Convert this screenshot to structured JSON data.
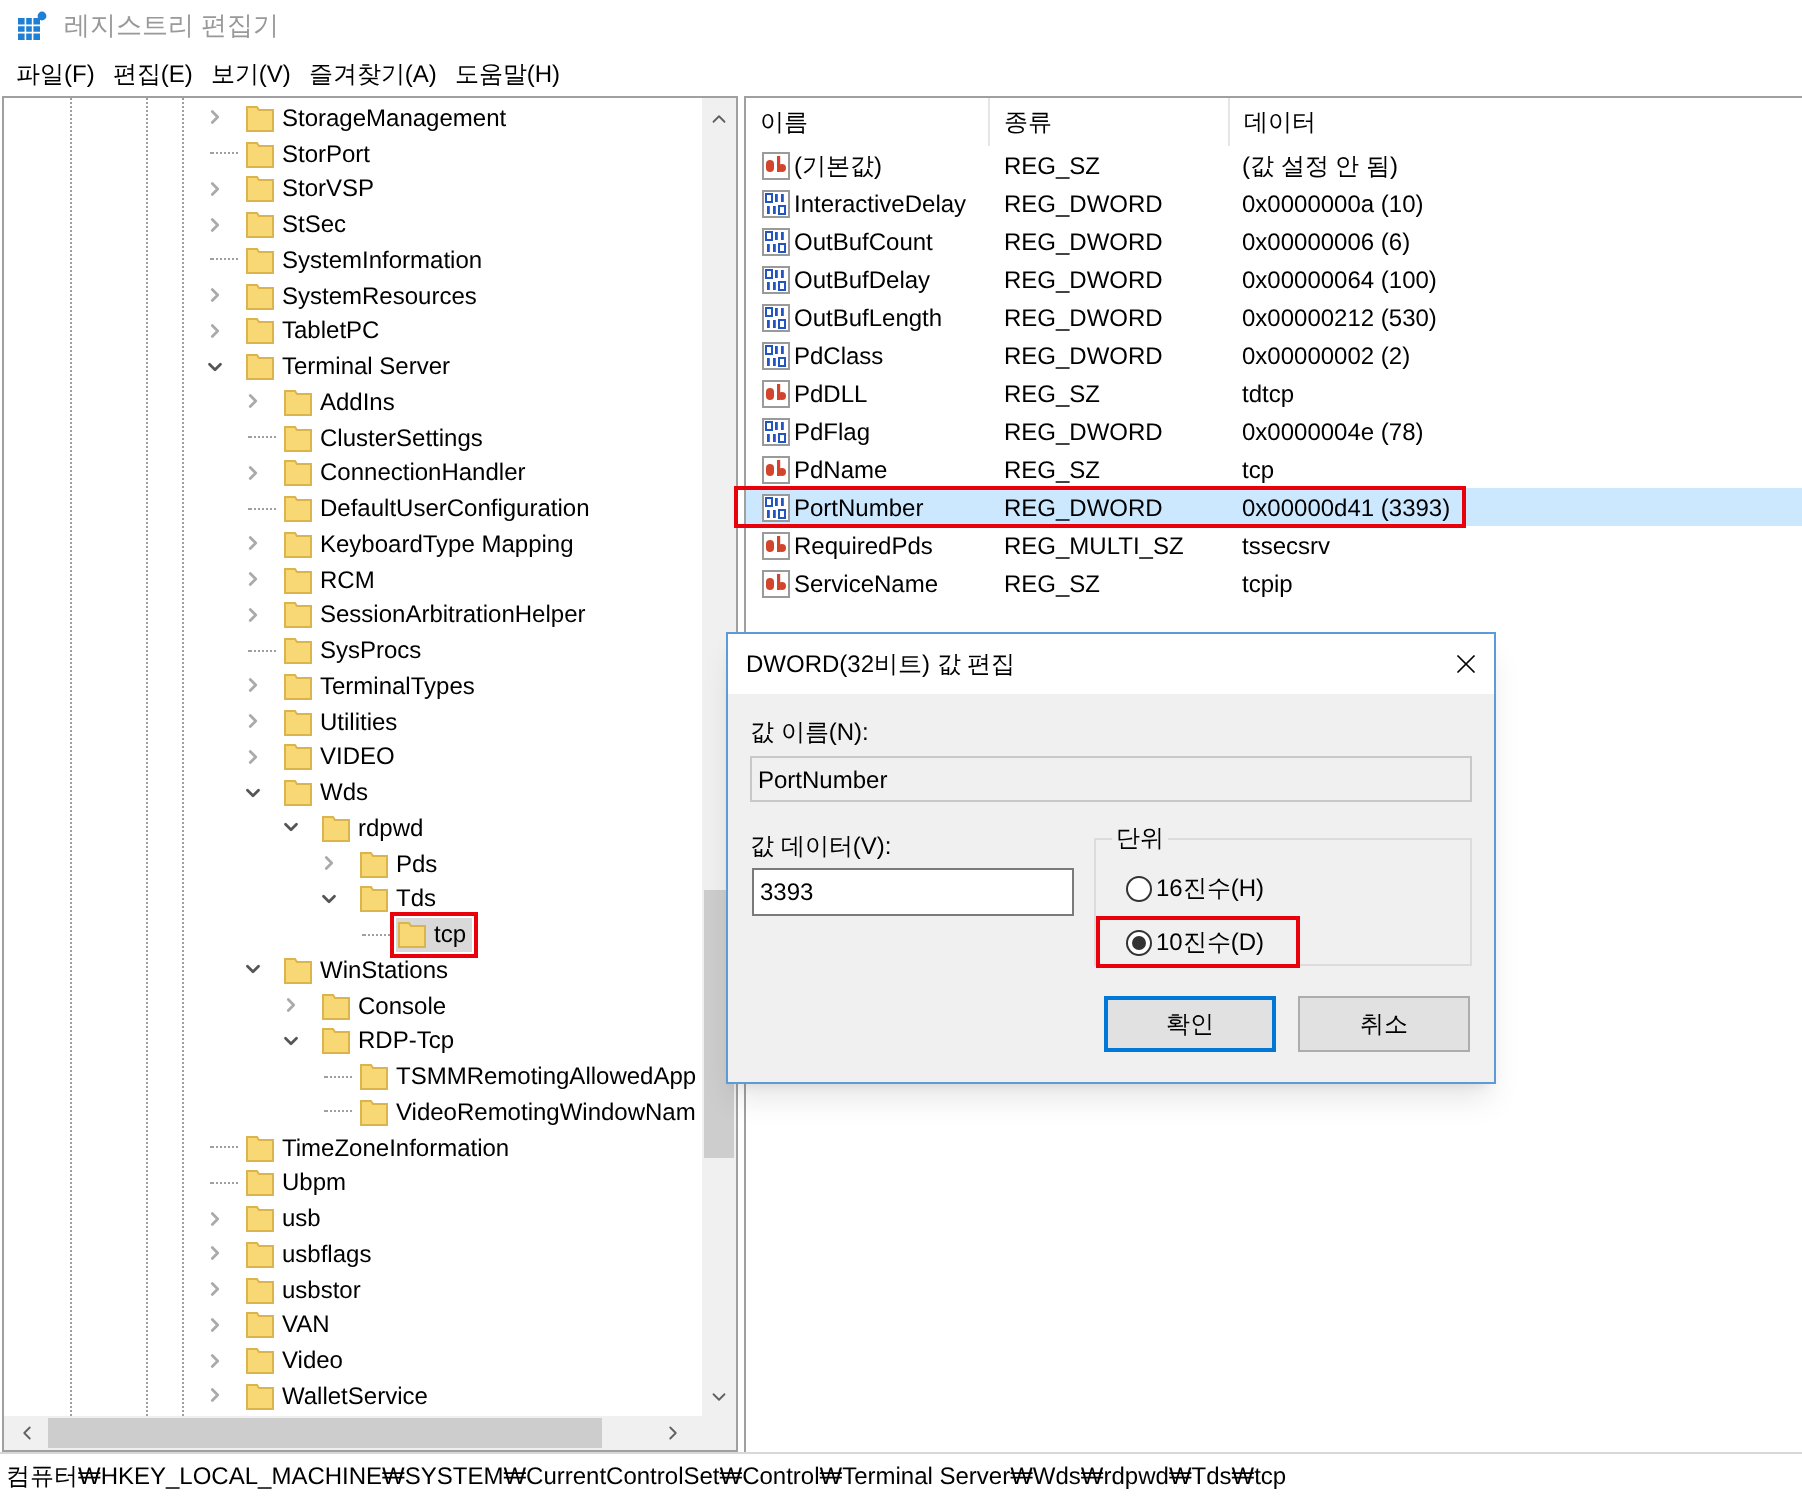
{
  "window": {
    "title": "레지스트리 편집기"
  },
  "menu": [
    "파일(F)",
    "편집(E)",
    "보기(V)",
    "즐겨찾기(A)",
    "도움말(H)"
  ],
  "tree": [
    {
      "label": "StorageManagement",
      "kind": "collapsed",
      "selected": false,
      "annotated": false
    },
    {
      "label": "StorPort",
      "kind": "leaf",
      "selected": false,
      "annotated": false
    },
    {
      "label": "StorVSP",
      "kind": "collapsed",
      "selected": false,
      "annotated": false
    },
    {
      "label": "StSec",
      "kind": "collapsed",
      "selected": false,
      "annotated": false
    },
    {
      "label": "SystemInformation",
      "kind": "leaf",
      "selected": false,
      "annotated": false
    },
    {
      "label": "SystemResources",
      "kind": "collapsed",
      "selected": false,
      "annotated": false
    },
    {
      "label": "TabletPC",
      "kind": "collapsed",
      "selected": false,
      "annotated": false
    },
    {
      "label": "Terminal Server",
      "kind": "expanded",
      "selected": false,
      "annotated": false,
      "children": [
        {
          "label": "AddIns",
          "kind": "collapsed",
          "selected": false,
          "annotated": false
        },
        {
          "label": "ClusterSettings",
          "kind": "leaf",
          "selected": false,
          "annotated": false
        },
        {
          "label": "ConnectionHandler",
          "kind": "collapsed",
          "selected": false,
          "annotated": false
        },
        {
          "label": "DefaultUserConfiguration",
          "kind": "leaf",
          "selected": false,
          "annotated": false
        },
        {
          "label": "KeyboardType Mapping",
          "kind": "collapsed",
          "selected": false,
          "annotated": false
        },
        {
          "label": "RCM",
          "kind": "collapsed",
          "selected": false,
          "annotated": false
        },
        {
          "label": "SessionArbitrationHelper",
          "kind": "collapsed",
          "selected": false,
          "annotated": false
        },
        {
          "label": "SysProcs",
          "kind": "leaf",
          "selected": false,
          "annotated": false
        },
        {
          "label": "TerminalTypes",
          "kind": "collapsed",
          "selected": false,
          "annotated": false
        },
        {
          "label": "Utilities",
          "kind": "collapsed",
          "selected": false,
          "annotated": false
        },
        {
          "label": "VIDEO",
          "kind": "collapsed",
          "selected": false,
          "annotated": false
        },
        {
          "label": "Wds",
          "kind": "expanded",
          "selected": false,
          "annotated": false,
          "children": [
            {
              "label": "rdpwd",
              "kind": "expanded",
              "selected": false,
              "annotated": false,
              "children": [
                {
                  "label": "Pds",
                  "kind": "collapsed",
                  "selected": false,
                  "annotated": false
                },
                {
                  "label": "Tds",
                  "kind": "expanded",
                  "selected": false,
                  "annotated": false,
                  "children": [
                    {
                      "label": "tcp",
                      "kind": "leaf",
                      "selected": true,
                      "annotated": true
                    }
                  ]
                }
              ]
            }
          ]
        },
        {
          "label": "WinStations",
          "kind": "expanded",
          "selected": false,
          "annotated": false,
          "children": [
            {
              "label": "Console",
              "kind": "collapsed",
              "selected": false,
              "annotated": false
            },
            {
              "label": "RDP-Tcp",
              "kind": "expanded",
              "selected": false,
              "annotated": false,
              "children": [
                {
                  "label": "TSMMRemotingAllowedApp",
                  "kind": "leaf",
                  "selected": false,
                  "annotated": false
                },
                {
                  "label": "VideoRemotingWindowNam",
                  "kind": "leaf",
                  "selected": false,
                  "annotated": false
                }
              ]
            }
          ]
        }
      ]
    },
    {
      "label": "TimeZoneInformation",
      "kind": "leaf",
      "selected": false,
      "annotated": false
    },
    {
      "label": "Ubpm",
      "kind": "leaf",
      "selected": false,
      "annotated": false
    },
    {
      "label": "usb",
      "kind": "collapsed",
      "selected": false,
      "annotated": false
    },
    {
      "label": "usbflags",
      "kind": "collapsed",
      "selected": false,
      "annotated": false
    },
    {
      "label": "usbstor",
      "kind": "collapsed",
      "selected": false,
      "annotated": false
    },
    {
      "label": "VAN",
      "kind": "collapsed",
      "selected": false,
      "annotated": false
    },
    {
      "label": "Video",
      "kind": "collapsed",
      "selected": false,
      "annotated": false
    },
    {
      "label": "WalletService",
      "kind": "collapsed",
      "selected": false,
      "annotated": false
    }
  ],
  "values": {
    "columns": [
      "이름",
      "종류",
      "데이터"
    ],
    "rows": [
      {
        "name": "(기본값)",
        "type": "REG_SZ",
        "data": "(값 설정 안 됨)",
        "kind": "string",
        "selected": false,
        "annotated": false
      },
      {
        "name": "InteractiveDelay",
        "type": "REG_DWORD",
        "data": "0x0000000a (10)",
        "kind": "binary",
        "selected": false,
        "annotated": false
      },
      {
        "name": "OutBufCount",
        "type": "REG_DWORD",
        "data": "0x00000006 (6)",
        "kind": "binary",
        "selected": false,
        "annotated": false
      },
      {
        "name": "OutBufDelay",
        "type": "REG_DWORD",
        "data": "0x00000064 (100)",
        "kind": "binary",
        "selected": false,
        "annotated": false
      },
      {
        "name": "OutBufLength",
        "type": "REG_DWORD",
        "data": "0x00000212 (530)",
        "kind": "binary",
        "selected": false,
        "annotated": false
      },
      {
        "name": "PdClass",
        "type": "REG_DWORD",
        "data": "0x00000002 (2)",
        "kind": "binary",
        "selected": false,
        "annotated": false
      },
      {
        "name": "PdDLL",
        "type": "REG_SZ",
        "data": "tdtcp",
        "kind": "string",
        "selected": false,
        "annotated": false
      },
      {
        "name": "PdFlag",
        "type": "REG_DWORD",
        "data": "0x0000004e (78)",
        "kind": "binary",
        "selected": false,
        "annotated": false
      },
      {
        "name": "PdName",
        "type": "REG_SZ",
        "data": "tcp",
        "kind": "string",
        "selected": false,
        "annotated": false
      },
      {
        "name": "PortNumber",
        "type": "REG_DWORD",
        "data": "0x00000d41 (3393)",
        "kind": "binary",
        "selected": true,
        "annotated": true
      },
      {
        "name": "RequiredPds",
        "type": "REG_MULTI_SZ",
        "data": "tssecsrv",
        "kind": "string",
        "selected": false,
        "annotated": false
      },
      {
        "name": "ServiceName",
        "type": "REG_SZ",
        "data": "tcpip",
        "kind": "string",
        "selected": false,
        "annotated": false
      }
    ]
  },
  "dialog": {
    "title": "DWORD(32비트) 값 편집",
    "name_label": "값 이름(N):",
    "name_value": "PortNumber",
    "data_label": "값 데이터(V):",
    "data_value": "3393",
    "unit_label": "단위",
    "units": [
      {
        "label": "16진수(H)",
        "selected": false,
        "annotated": false
      },
      {
        "label": "10진수(D)",
        "selected": true,
        "annotated": true
      }
    ],
    "buttons": [
      {
        "label": "확인",
        "default": true
      },
      {
        "label": "취소",
        "default": false
      }
    ]
  },
  "status_bar": "컴퓨터₩HKEY_LOCAL_MACHINE₩SYSTEM₩CurrentControlSet₩Control₩Terminal Server₩Wds₩rdpwd₩Tds₩tcp"
}
